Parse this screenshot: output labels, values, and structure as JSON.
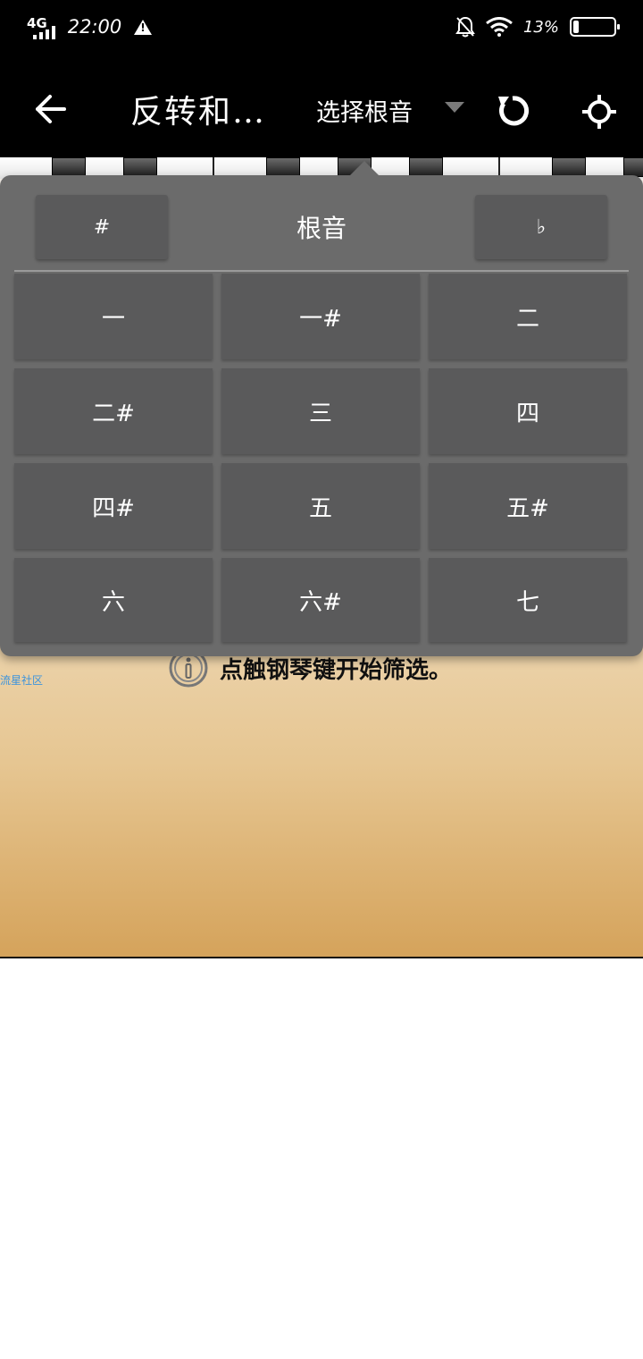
{
  "status_bar": {
    "network": "4G",
    "time": "22:00",
    "battery_percent_text": "13%",
    "battery_level": 0.13
  },
  "toolbar": {
    "title": "反转和…",
    "root_select_label": "选择根音"
  },
  "root_popup": {
    "title": "根音",
    "sharp_label": "#",
    "flat_label": "♭",
    "notes": [
      "一",
      "一#",
      "二",
      "二#",
      "三",
      "四",
      "四#",
      "五",
      "五#",
      "六",
      "六#",
      "七"
    ]
  },
  "main": {
    "hint_text": "点触钢琴键开始筛选。",
    "community_label": "流星社区"
  },
  "colors": {
    "popup_bg": "#6b6b6b",
    "button_bg": "#5a5a5b",
    "link_blue": "#3b93dd"
  }
}
